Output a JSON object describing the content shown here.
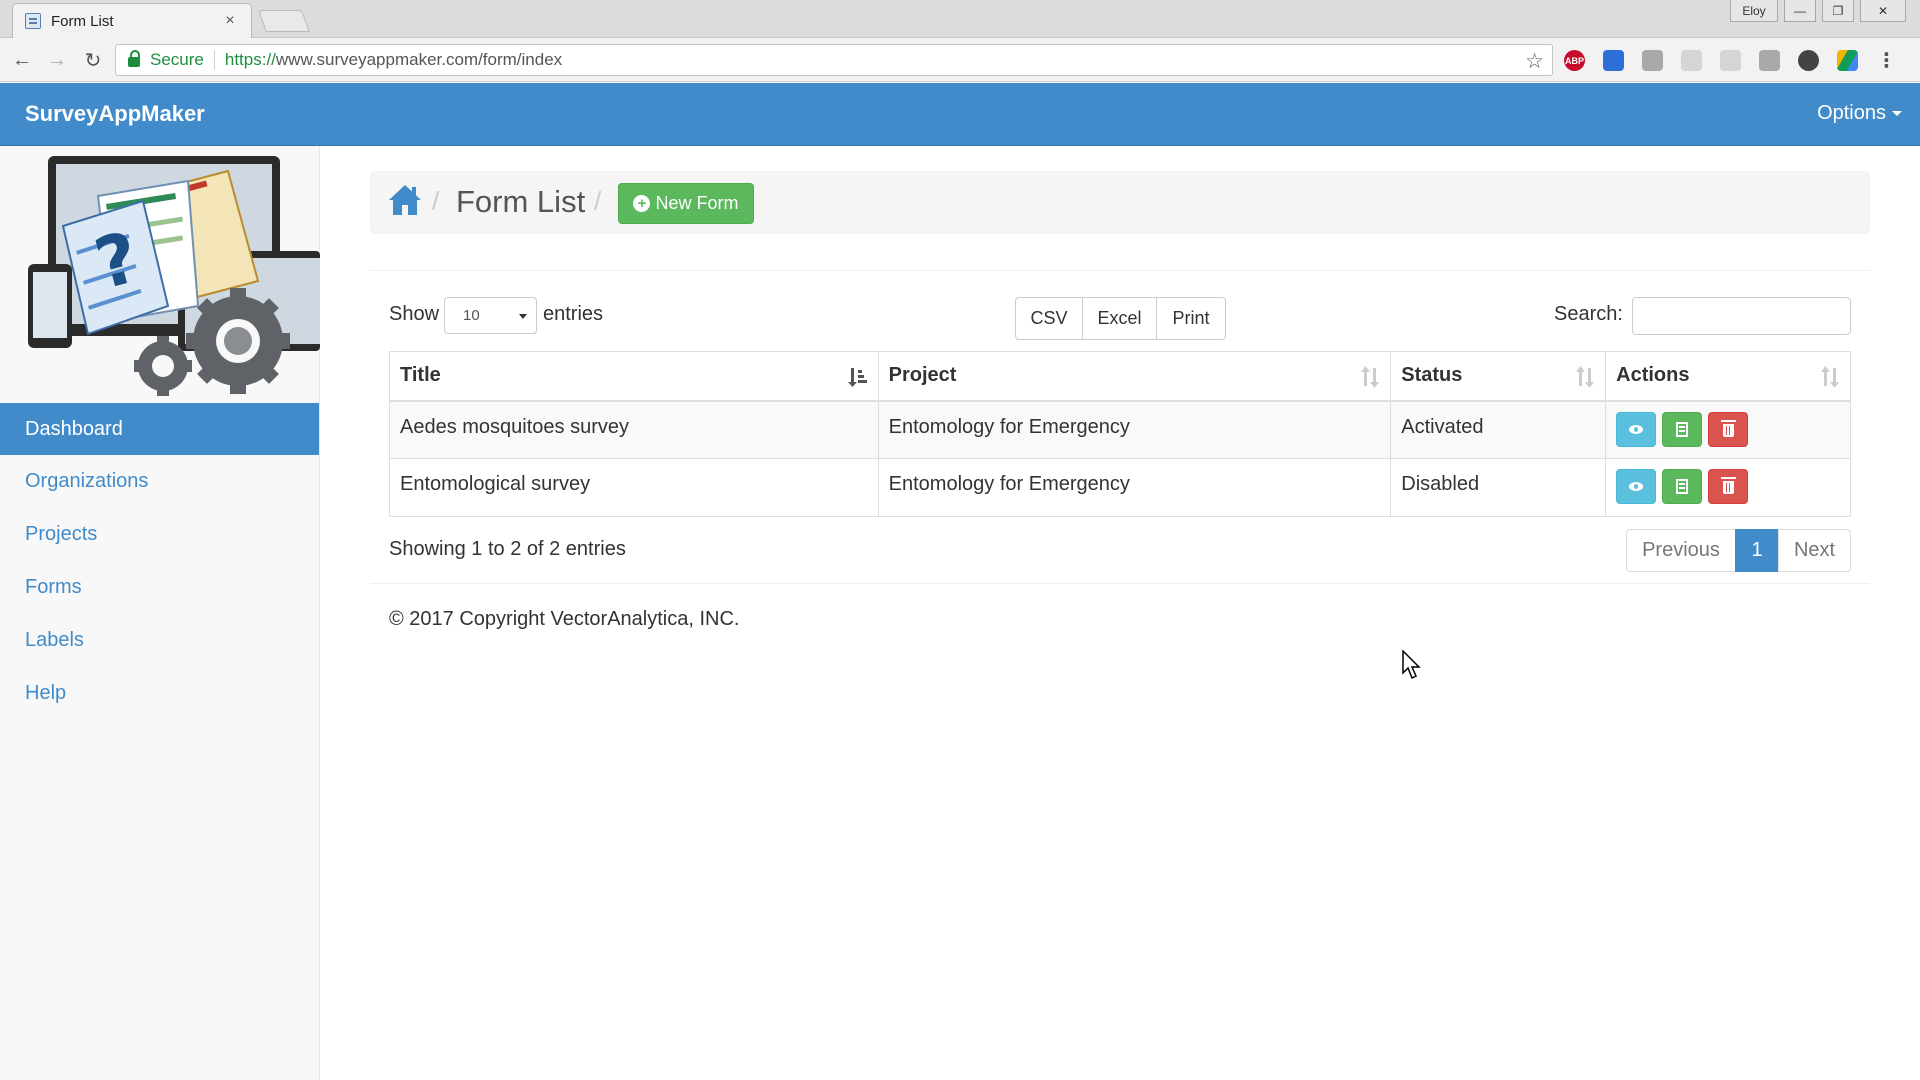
{
  "browser": {
    "tab_title": "Form List",
    "tab_close": "×",
    "user_label": "Eloy",
    "secure_label": "Secure",
    "url_scheme": "https://",
    "url_rest": "www.surveyappmaker.com/form/index",
    "ext_abp": "ABP"
  },
  "app": {
    "brand": "SurveyAppMaker",
    "options_label": "Options",
    "accent_color": "#428bca"
  },
  "sidebar": {
    "items": [
      {
        "label": "Dashboard",
        "active": true
      },
      {
        "label": "Organizations"
      },
      {
        "label": "Projects"
      },
      {
        "label": "Forms"
      },
      {
        "label": "Labels"
      },
      {
        "label": "Help"
      }
    ]
  },
  "breadcrumb": {
    "separator": "/",
    "title": "Form List",
    "new_form_label": "New Form"
  },
  "table_controls": {
    "show_label": "Show",
    "page_size": "10",
    "entries_label": "entries",
    "export_buttons": [
      "CSV",
      "Excel",
      "Print"
    ],
    "search_label": "Search:",
    "search_value": ""
  },
  "table": {
    "columns": [
      "Title",
      "Project",
      "Status",
      "Actions"
    ],
    "rows": [
      {
        "title": "Aedes mosquitoes survey",
        "project": "Entomology for Emergency",
        "status": "Activated"
      },
      {
        "title": "Entomological survey",
        "project": "Entomology for Emergency",
        "status": "Disabled"
      }
    ]
  },
  "pagination": {
    "info": "Showing 1 to 2 of 2 entries",
    "previous": "Previous",
    "current": "1",
    "next": "Next"
  },
  "footer": {
    "copyright": "© 2017 Copyright VectorAnalytica, INC."
  }
}
